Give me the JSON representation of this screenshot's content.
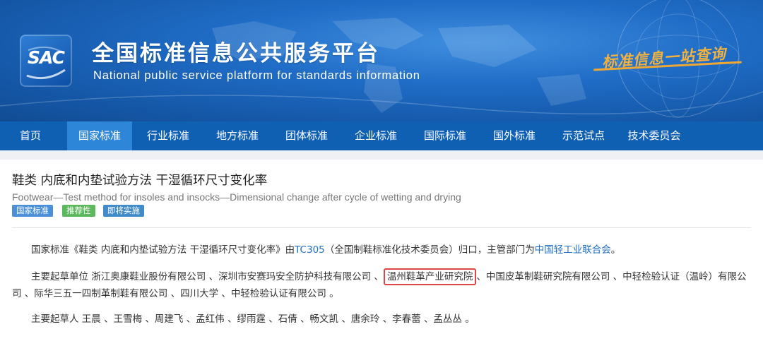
{
  "header": {
    "logo_text": "SAC",
    "title_cn": "全国标准信息公共服务平台",
    "title_en": "National public service platform  for standards information",
    "slogan": "标准信息一站查询"
  },
  "nav": {
    "items": [
      {
        "label": "首页"
      },
      {
        "label": "国家标准"
      },
      {
        "label": "行业标准"
      },
      {
        "label": "地方标准"
      },
      {
        "label": "团体标准"
      },
      {
        "label": "企业标准"
      },
      {
        "label": "国际标准"
      },
      {
        "label": "国外标准"
      },
      {
        "label": "示范试点"
      },
      {
        "label": "技术委员会"
      }
    ],
    "active": "国家标准"
  },
  "standard": {
    "title_cn": "鞋类 内底和内垫试验方法 干湿循环尺寸变化率",
    "title_en": "Footwear—Test method for insoles and insocks—Dimensional change after cycle of wetting and drying",
    "badges": [
      "国家标准",
      "推荐性",
      "即将实施"
    ],
    "p1": {
      "pre": "国家标准《鞋类 内底和内垫试验方法 干湿循环尺寸变化率》由",
      "tc_link": "TC305",
      "mid": "（全国制鞋标准化技术委员会）归口，主管部门为",
      "dept_link": "中国轻工业联合会",
      "post": "。"
    },
    "p2": {
      "pre": "主要起草单位 浙江奥康鞋业股份有限公司 、深圳市安赛玛安全防护科技有限公司 、",
      "highlight": "温州鞋革产业研究院",
      "post": "、中国皮革制鞋研究院有限公司 、中轻检验认证（温岭）有限公司 、际华三五一四制革制鞋有限公司 、四川大学 、中轻检验认证有限公司 。"
    },
    "p3": "主要起草人 王晨 、王雪梅 、周建飞 、孟红伟 、缪雨霆 、石倩 、畅文凯 、唐余玲 、李春蕾 、孟丛丛 。"
  },
  "colors": {
    "banner": "#1a62b6",
    "nav": "#0f5fb3",
    "nav_active": "#2d86d8",
    "link": "#1d6fc4",
    "highlight_border": "#e04545",
    "slogan": "#f3b23e"
  }
}
